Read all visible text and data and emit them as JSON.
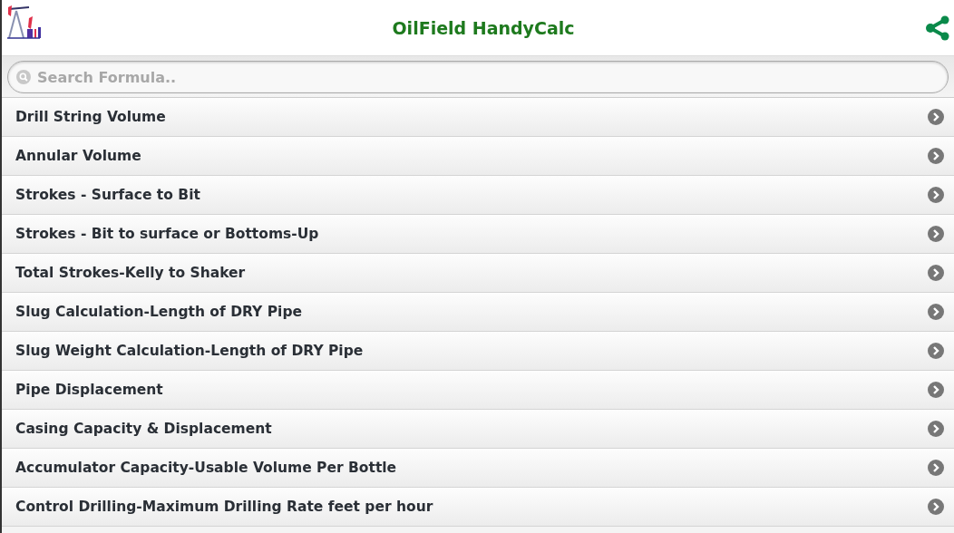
{
  "header": {
    "title": "OilField HandyCalc"
  },
  "search": {
    "placeholder": "Search Formula.."
  },
  "formulas": [
    {
      "label": "Drill String Volume"
    },
    {
      "label": "Annular Volume"
    },
    {
      "label": "Strokes - Surface to Bit"
    },
    {
      "label": "Strokes - Bit to surface or Bottoms-Up"
    },
    {
      "label": "Total Strokes-Kelly to Shaker"
    },
    {
      "label": "Slug Calculation-Length of DRY Pipe"
    },
    {
      "label": "Slug Weight Calculation-Length of DRY Pipe"
    },
    {
      "label": "Pipe Displacement"
    },
    {
      "label": "Casing Capacity & Displacement"
    },
    {
      "label": "Accumulator Capacity-Usable Volume Per Bottle"
    },
    {
      "label": "Control Drilling-Maximum Drilling Rate feet per hour"
    }
  ]
}
